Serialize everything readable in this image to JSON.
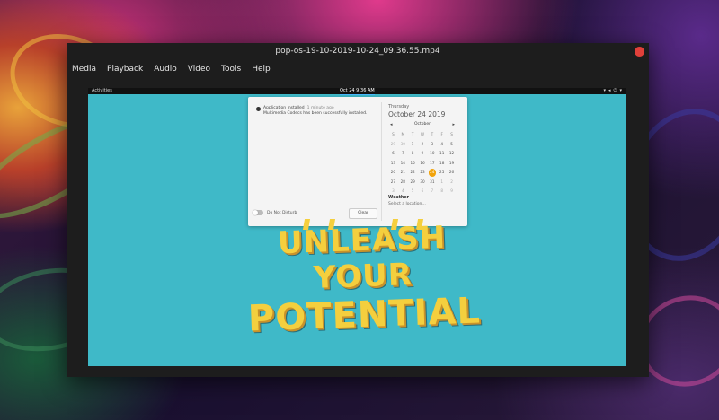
{
  "window": {
    "title": "pop-os-19-10-2019-10-24_09.36.55.mp4",
    "close_color": "#e0403a"
  },
  "menu": [
    "Media",
    "Playback",
    "Audio",
    "Video",
    "Tools",
    "Help"
  ],
  "video": {
    "background": "#3fb9c8",
    "topbar": {
      "activities": "Activities",
      "clock": "Oct 24  9:36 AM",
      "tray_icons": [
        "network-icon",
        "volume-icon",
        "power-icon",
        "chevron-down-icon"
      ]
    },
    "notification_panel": {
      "entry": {
        "title": "Application installed",
        "time": "1 minute ago",
        "body": "Multimedia Codecs has been successfully installed."
      },
      "dnd_label": "Do Not Disturb",
      "clear_label": "Clear",
      "weekday": "Thursday",
      "date_long": "October 24 2019",
      "calendar": {
        "month": "October",
        "weekday_headers": [
          "S",
          "M",
          "T",
          "W",
          "T",
          "F",
          "S"
        ],
        "days": [
          [
            "29",
            "30",
            "1",
            "2",
            "3",
            "4",
            "5"
          ],
          [
            "6",
            "7",
            "8",
            "9",
            "10",
            "11",
            "12"
          ],
          [
            "13",
            "14",
            "15",
            "16",
            "17",
            "18",
            "19"
          ],
          [
            "20",
            "21",
            "22",
            "23",
            "24",
            "25",
            "26"
          ],
          [
            "27",
            "28",
            "29",
            "30",
            "31",
            "1",
            "2"
          ],
          [
            "3",
            "4",
            "5",
            "6",
            "7",
            "8",
            "9"
          ]
        ],
        "today": "24"
      },
      "weather_title": "Weather",
      "weather_sub": "Select a location…"
    },
    "poster": {
      "line1": "UNLEASH YOUR",
      "line2": "POTENTIAL",
      "color": "#f4cf3e"
    }
  }
}
